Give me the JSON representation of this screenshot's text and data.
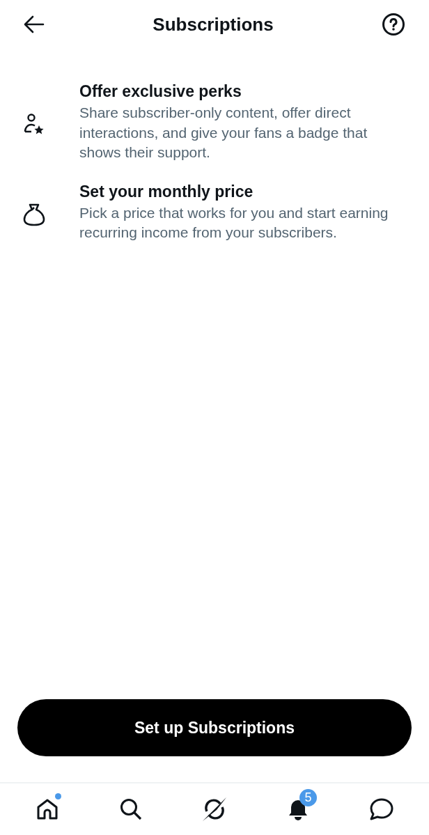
{
  "header": {
    "title": "Subscriptions"
  },
  "features": [
    {
      "kind": "perks",
      "title": "Offer exclusive perks",
      "description": "Share subscriber-only content, offer direct interactions, and give your fans a badge that shows their support."
    },
    {
      "kind": "price",
      "title": "Set your monthly price",
      "description": "Pick a price that works for you and start earning recurring income from your subscribers."
    }
  ],
  "primary_button": "Set up Subscriptions",
  "tab_bar": [
    {
      "kind": "home",
      "selected": false,
      "dot": true
    },
    {
      "kind": "search",
      "selected": false
    },
    {
      "kind": "spaces",
      "selected": false
    },
    {
      "kind": "notifications",
      "selected": true,
      "badge": "5"
    },
    {
      "kind": "messages",
      "selected": false
    }
  ]
}
